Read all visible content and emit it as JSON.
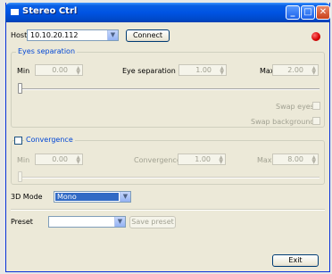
{
  "window": {
    "title": "Stereo Ctrl",
    "controls": {
      "minimize": "_",
      "maximize": "□",
      "close": "✕"
    }
  },
  "host": {
    "label": "Host",
    "value": "10.10.20.112",
    "connect_label": "Connect",
    "status_color": "#d40000"
  },
  "eyes_separation": {
    "title": "Eyes separation",
    "min_label": "Min",
    "min_value": "0.00",
    "sep_label": "Eye separation",
    "sep_value": "1.00",
    "max_label": "Max",
    "max_value": "2.00",
    "slider_value": 0,
    "swap_eyes_label": "Swap eyes",
    "swap_eyes_checked": false,
    "swap_backgrounds_label": "Swap backgrounds",
    "swap_backgrounds_checked": false
  },
  "convergence": {
    "title": "Convergence",
    "checked": false,
    "min_label": "Min",
    "min_value": "0.00",
    "conv_label": "Convergence",
    "conv_value": "1.00",
    "max_label": "Max",
    "max_value": "8.00",
    "slider_value": 0
  },
  "mode": {
    "label": "3D Mode",
    "value": "Mono"
  },
  "preset": {
    "label": "Preset",
    "value": "",
    "save_label": "Save preset"
  },
  "exit_label": "Exit",
  "colors": {
    "title_bar": "#0054e3",
    "accent": "#316ac5",
    "group_title": "#0046d5"
  },
  "icons": [
    "window-icon",
    "minimize-icon",
    "maximize-icon",
    "close-icon",
    "chevron-down-icon",
    "spin-arrows-icon",
    "status-indicator"
  ]
}
